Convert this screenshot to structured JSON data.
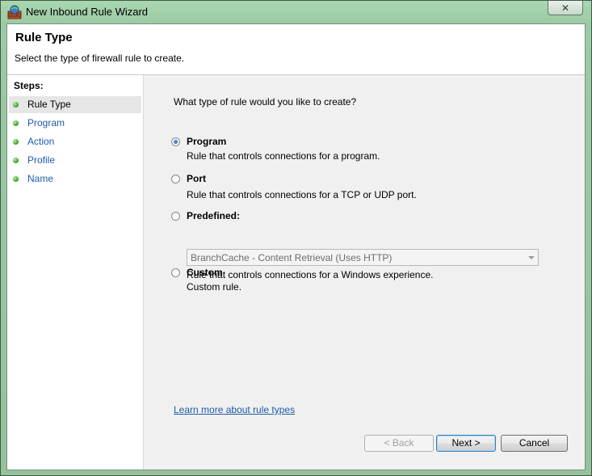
{
  "window": {
    "title": "New Inbound Rule Wizard",
    "close_glyph": "✕"
  },
  "header": {
    "title": "Rule Type",
    "subtitle": "Select the type of firewall rule to create."
  },
  "steps": {
    "label": "Steps:",
    "items": [
      {
        "label": "Rule Type",
        "current": true
      },
      {
        "label": "Program",
        "current": false
      },
      {
        "label": "Action",
        "current": false
      },
      {
        "label": "Profile",
        "current": false
      },
      {
        "label": "Name",
        "current": false
      }
    ]
  },
  "main": {
    "question": "What type of rule would you like to create?",
    "options": [
      {
        "label": "Program",
        "description": "Rule that controls connections for a program.",
        "selected": true
      },
      {
        "label": "Port",
        "description": "Rule that controls connections for a TCP or UDP port.",
        "selected": false
      },
      {
        "label": "Predefined:",
        "description": "Rule that controls connections for a Windows experience.",
        "selected": false
      },
      {
        "label": "Custom",
        "description": "Custom rule.",
        "selected": false
      }
    ],
    "predefined_combo": {
      "value": "BranchCache - Content Retrieval (Uses HTTP)",
      "disabled": true
    },
    "learn_more": "Learn more about rule types"
  },
  "buttons": {
    "back": "< Back",
    "next": "Next >",
    "cancel": "Cancel"
  },
  "colors": {
    "link": "#1e5ba8",
    "step_dot": "#2e9a1e",
    "frame": "#9ccaa4"
  }
}
